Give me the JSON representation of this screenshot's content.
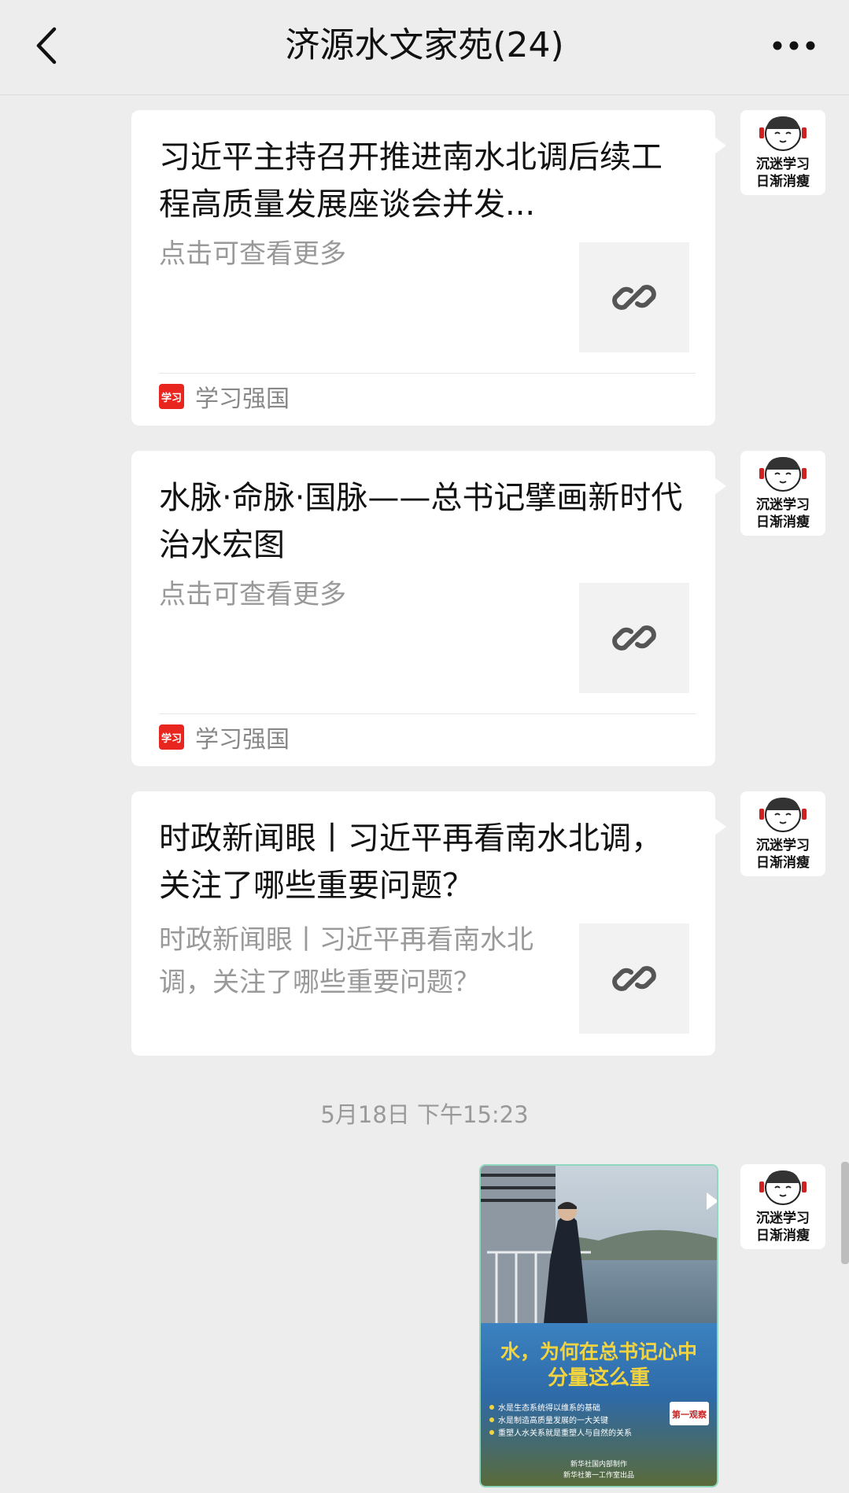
{
  "header": {
    "title": "济源水文家苑(24)",
    "back_icon": "chevron-left-icon",
    "more_icon": "ellipsis-icon"
  },
  "sender": {
    "avatar_line1": "沉迷学习",
    "avatar_line2": "日渐消瘦"
  },
  "messages": [
    {
      "title": "习近平主持召开推进南水北调后续工程高质量发展座谈会并发...",
      "description": "点击可查看更多",
      "source_label": "学习强国",
      "source_icon_text": "学习",
      "thumb_icon": "link-icon"
    },
    {
      "title": "水脉·命脉·国脉——总书记擘画新时代治水宏图",
      "description": "点击可查看更多",
      "source_label": "学习强国",
      "source_icon_text": "学习",
      "thumb_icon": "link-icon"
    },
    {
      "title": "时政新闻眼丨习近平再看南水北调，关注了哪些重要问题？",
      "description": "时政新闻眼丨习近平再看南水北调，关注了哪些重要问题？",
      "thumb_icon": "link-icon"
    }
  ],
  "timestamp": "5月18日 下午15:23",
  "poster": {
    "headline_line1": "水，为何在总书记心中",
    "headline_line2": "分量这么重",
    "bullets": [
      "水是生态系统得以维系的基础",
      "水是制造高质量发展的一大关键",
      "重塑人水关系就是重塑人与自然的关系"
    ],
    "badge": "第一观察",
    "footer_line1": "新华社国内部制作",
    "footer_line2": "新华社第一工作室出品"
  },
  "colors": {
    "background": "#ededed",
    "card": "#ffffff",
    "source_red": "#e8251f"
  }
}
